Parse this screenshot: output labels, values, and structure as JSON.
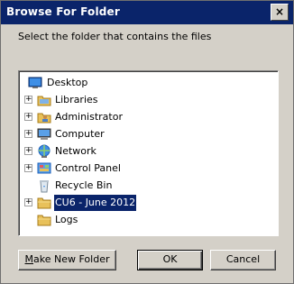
{
  "window": {
    "title": "Browse For Folder",
    "close_glyph": "×"
  },
  "instruction": "Select the folder that contains the files",
  "tree": {
    "items": [
      {
        "label": "Desktop",
        "icon": "desktop-icon",
        "expander": "",
        "selected": false
      },
      {
        "label": "Libraries",
        "icon": "libraries-icon",
        "expander": "+",
        "selected": false
      },
      {
        "label": "Administrator",
        "icon": "user-folder-icon",
        "expander": "+",
        "selected": false
      },
      {
        "label": "Computer",
        "icon": "computer-icon",
        "expander": "+",
        "selected": false
      },
      {
        "label": "Network",
        "icon": "network-icon",
        "expander": "+",
        "selected": false
      },
      {
        "label": "Control Panel",
        "icon": "control-panel-icon",
        "expander": "+",
        "selected": false
      },
      {
        "label": "Recycle Bin",
        "icon": "recycle-bin-icon",
        "expander": "",
        "selected": false
      },
      {
        "label": "CU6 - June 2012",
        "icon": "folder-icon",
        "expander": "+",
        "selected": true
      },
      {
        "label": "Logs",
        "icon": "folder-icon",
        "expander": "",
        "selected": false
      }
    ]
  },
  "buttons": {
    "make_new_folder": {
      "accel": "M",
      "rest": "ake New Folder"
    },
    "ok": "OK",
    "cancel": "Cancel"
  },
  "colors": {
    "title_bar": "#0a246a",
    "dialog_face": "#d4d0c8",
    "selection": "#0a246a",
    "folder": "#e8c15a"
  }
}
